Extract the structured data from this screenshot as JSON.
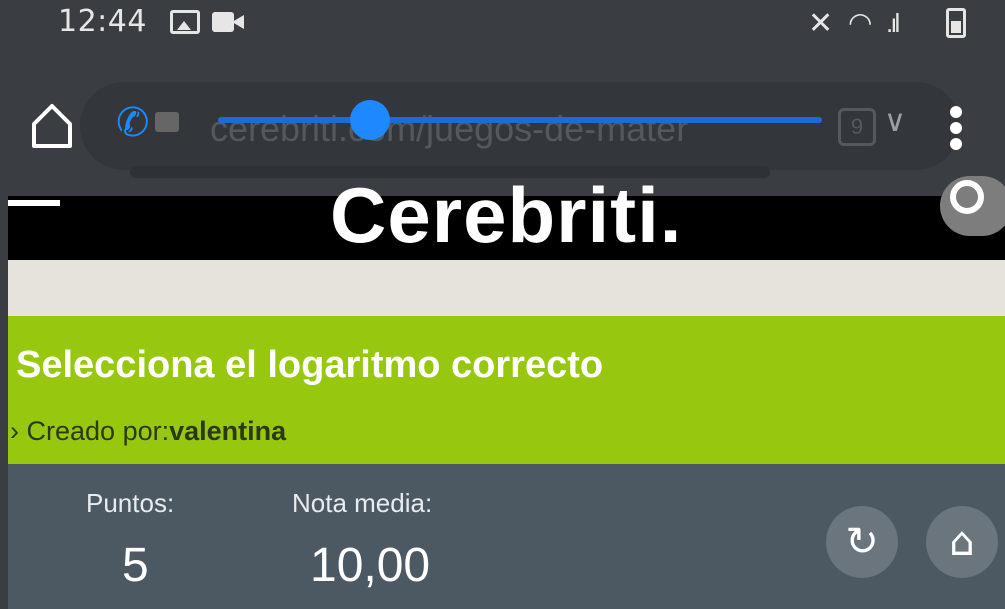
{
  "status_bar": {
    "time": "12:44",
    "icons": [
      "image-icon",
      "video-icon",
      "mute-icon",
      "wifi-icon",
      "signal-icon",
      "battery-icon"
    ]
  },
  "browser": {
    "url": "cerebriti.com/juegos-de-mater",
    "tab_count": "9",
    "call_overlay_volume": 0.25,
    "accent_color": "#1e88ff"
  },
  "site": {
    "logo": "Cerebriti.",
    "header_color": "#000000"
  },
  "quiz": {
    "title": "Selecciona el logaritmo correcto",
    "created_by_label": "Creado por:",
    "author": "valentina",
    "header_color": "#97c80f"
  },
  "stats": {
    "points_label": "Puntos:",
    "points_value": "5",
    "average_label": "Nota media:",
    "average_value": "10,00",
    "panel_color": "#4c5963"
  }
}
